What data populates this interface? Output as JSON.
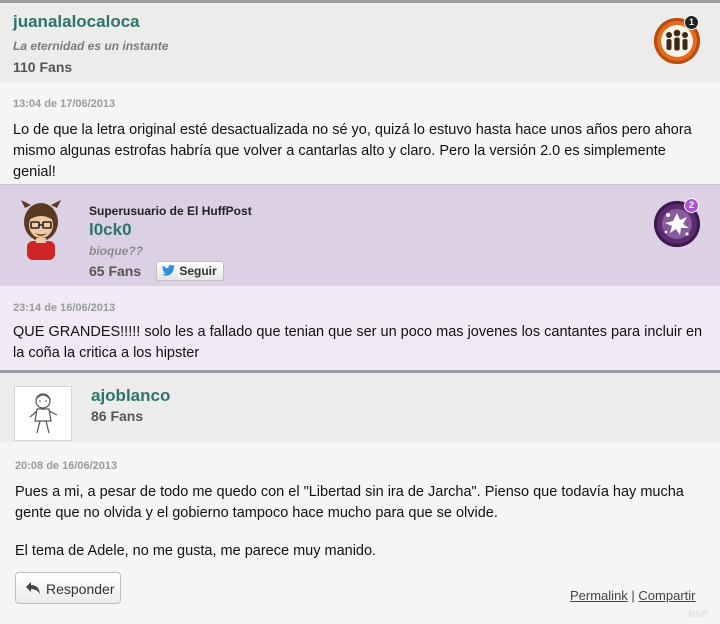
{
  "comments": [
    {
      "username": "juanalalocaloca",
      "tagline": "La eternidad es un instante",
      "fans": "110 Fans",
      "badge_count": "1",
      "timestamp": "13:04 de 17/06/2013",
      "text": "Lo de que la letra original esté desactualizada no sé yo, quizá lo estuvo hasta hace unos años pero ahora mismo algunas estrofas habría que volver a cantarlas alto y claro. Pero la versión 2.0 es simplemente genial!"
    },
    {
      "role": "Superusuario de El HuffPost",
      "username": "l0ck0",
      "tagline": "bioque??",
      "fans": "65 Fans",
      "follow_label": "Seguir",
      "badge_count": "2",
      "timestamp": "23:14 de 16/06/2013",
      "text": "QUE GRANDES!!!!! solo les a fallado que tenian que ser un poco mas jovenes los cantantes para incluir en la coña la critica a los hipster"
    },
    {
      "username": "ajoblanco",
      "fans": "86 Fans",
      "timestamp": "20:08 de 16/06/2013",
      "text_p1": "Pues a mi, a pesar de todo me quedo con el \"Libertad sin ira de Jarcha\". Pienso que todavía hay mucha gente que no olvida y el gobierno tampoco hace mucho para que se olvide.",
      "text_p2": "El tema de Adele, no me gusta, me parece muy manido.",
      "reply_label": "Responder",
      "permalink_label": "Permalink",
      "share_label": "Compartir"
    }
  ],
  "watermark": "BNP",
  "colors": {
    "username": "#2f7468",
    "header_gray": "#ececec",
    "body_gray": "#f5f5f5",
    "superuser_header": "#dcd0e4",
    "superuser_body": "#f1e9f3",
    "badge_orange": "#e36a1e",
    "badge_purple": "#5b2c6f"
  },
  "icons": {
    "badge_1": "people-group-badge-icon",
    "badge_2": "splash-badge-icon",
    "twitter": "twitter-bird-icon",
    "reply": "reply-arrow-icon"
  }
}
